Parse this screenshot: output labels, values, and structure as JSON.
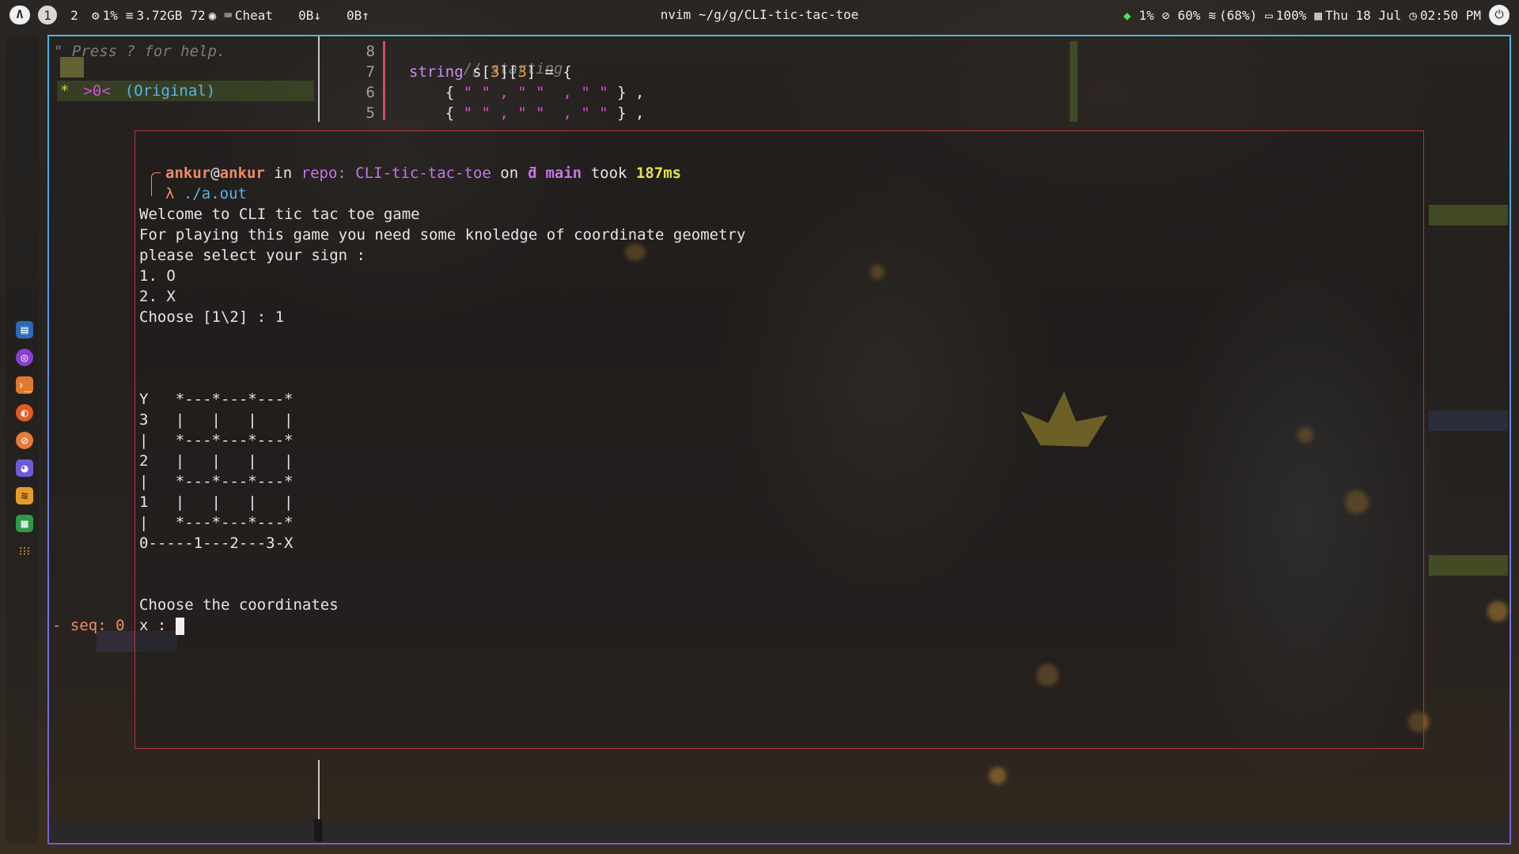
{
  "topbar": {
    "logo_glyph": "Λ",
    "workspaces": [
      "1",
      "2"
    ],
    "active_workspace": "1",
    "cpu": "1%",
    "memory": "3.72GB",
    "temperature": "72",
    "cheat_label": "Cheat",
    "net_down": "0B↓",
    "net_up": "0B↑",
    "window_title": "nvim ~/g/g/CLI-tic-tac-toe",
    "wifi_percent": "1%",
    "brightness": "60%",
    "wifi_strength": "(68%)",
    "battery": "100%",
    "date": "Thu 18 Jul",
    "time": "02:50 PM"
  },
  "nvim_tree": {
    "help_text": "\" Press ? for help.",
    "star": "*",
    "seq": ">0<",
    "original": "(Original)"
  },
  "editor": {
    "lines": [
      {
        "num": "8",
        "comment": "// starting"
      },
      {
        "num": "7",
        "type": "string",
        "rest_a": " s[",
        "n1": "3",
        "rest_b": "][",
        "n2": "3",
        "rest_c": "] = {"
      },
      {
        "num": "6",
        "text_a": "    { ",
        "strs": "\" \" , \" \"  , \" \"",
        "text_b": " } ,"
      },
      {
        "num": "5",
        "text_a": "    { ",
        "strs": "\" \" , \" \"  , \" \"",
        "text_b": " } ,"
      }
    ]
  },
  "terminal": {
    "prompt": {
      "user": "ankur",
      "at": "@",
      "host": "ankur",
      "in": " in ",
      "repo": "repo: CLI-tic-tac-toe",
      "on": " on ",
      "branch": "ƌ main",
      "took": " took ",
      "duration": "187ms",
      "lambda": "λ",
      "command": "./a.out"
    },
    "output": [
      "Welcome to CLI tic tac toe game",
      "For playing this game you need some knoledge of coordinate geometry",
      "please select your sign :",
      "1. O",
      "2. X",
      "Choose [1\\2] : 1"
    ],
    "board": [
      "Y   *---*---*---*",
      "3   |   |   |   |",
      "|   *---*---*---*",
      "2   |   |   |   |",
      "|   *---*---*---*",
      "1   |   |   |   |",
      "|   *---*---*---*",
      "0-----1---2---3-X"
    ],
    "ask": "Choose the coordinates",
    "input_prompt": "x : "
  },
  "undotree_footer": "- seq: 0",
  "colors": {
    "window_border_top": "#4fb6e8",
    "window_border_bottom": "#7a5cd8",
    "terminal_border": "#c0303a",
    "prompt_user": "#f08a6a",
    "prompt_repo": "#c774e8",
    "prompt_time": "#e8e24a"
  },
  "dock_icons": [
    "file-manager-icon",
    "browser-icon",
    "terminal-icon",
    "firefox-icon",
    "postman-icon",
    "discord-icon",
    "network-icon",
    "spreadsheet-icon",
    "app-grid-icon"
  ]
}
